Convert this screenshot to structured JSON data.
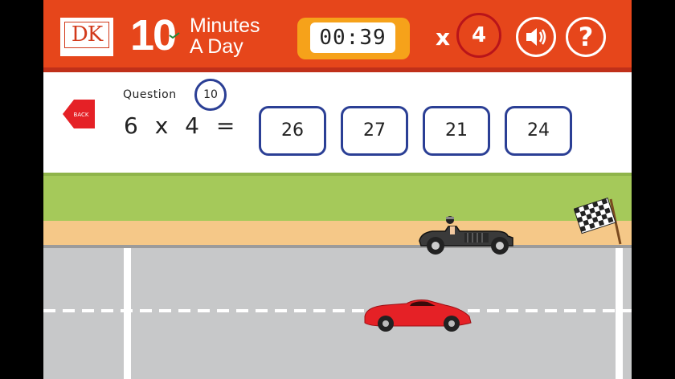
{
  "header": {
    "logo_text": "DK",
    "brand_number": "10",
    "brand_line1": "Minutes",
    "brand_line2": "A Day",
    "timer": "00:39",
    "multiplier_symbol": "x",
    "multiplier_value": "4",
    "sound_icon": "speaker-icon",
    "help_label": "?"
  },
  "question": {
    "back_label": "BACK",
    "label": "Question",
    "number": "10",
    "equation": "6 x 4 =",
    "answers": [
      "26",
      "27",
      "21",
      "24"
    ]
  },
  "colors": {
    "header_orange": "#e6461b",
    "timer_amber": "#f6a21a",
    "answer_border": "#2b3f95",
    "grass": "#a5c95a",
    "sand": "#f5c888",
    "road": "#c7c8c9",
    "player_car": "#e52126",
    "opponent_car": "#333333"
  }
}
